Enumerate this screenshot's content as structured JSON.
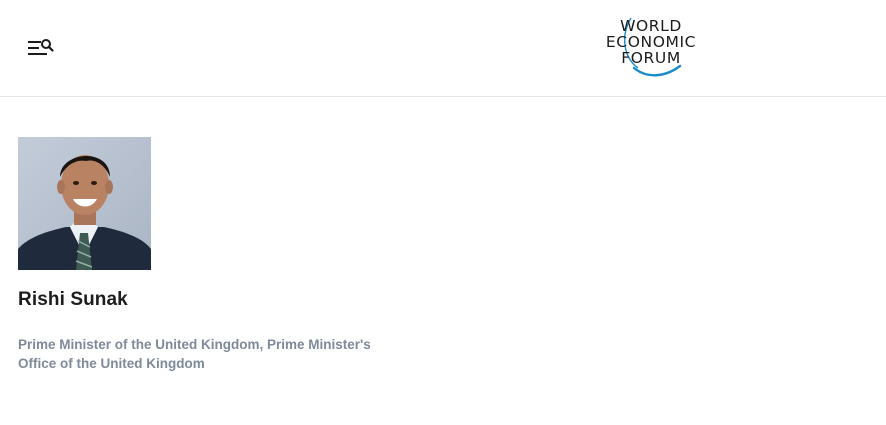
{
  "header": {
    "menu_icon": "menu-search-icon",
    "logo": {
      "line1": "WORLD",
      "line2": "ECONOMIC",
      "line3": "FORUM",
      "arc_color": "#1a8cc9"
    }
  },
  "person": {
    "photo_icon": "person-portrait",
    "name": "Rishi Sunak",
    "role": "Prime Minister of the United Kingdom, Prime Minister's Office of the United Kingdom"
  },
  "colors": {
    "text_primary": "#1d1d1d",
    "text_secondary": "#7e8a99",
    "divider": "#e6e6e6",
    "accent": "#1a8cc9"
  }
}
